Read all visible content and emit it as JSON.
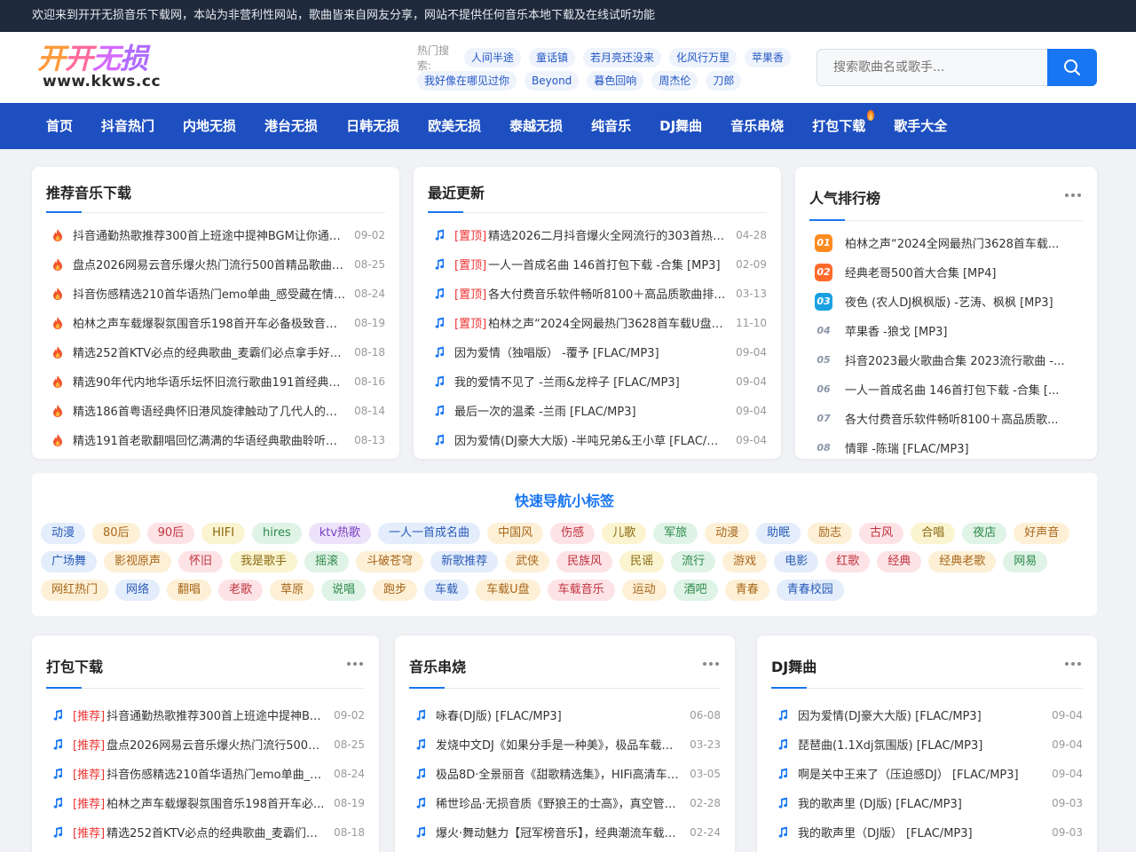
{
  "topbar": {
    "notice": "欢迎来到开开无损音乐下载网，本站为非营利性网站，歌曲皆来自网友分享，网站不提供任何音乐本地下载及在线试听功能"
  },
  "logo": {
    "chars": [
      "开",
      "开",
      "无",
      "损"
    ],
    "url": "www.kkws.cc"
  },
  "hot_search": {
    "label": "热门搜索:",
    "row1": [
      "人间半途",
      "童话镇",
      "若月亮还没来",
      "化风行万里",
      "苹果香"
    ],
    "row2": [
      "我好像在哪见过你",
      "Beyond",
      "暮色回响",
      "周杰伦",
      "刀郎"
    ]
  },
  "search": {
    "placeholder": "搜索歌曲名或歌手...",
    "icon": "search-icon"
  },
  "nav": [
    "首页",
    "抖音热门",
    "内地无损",
    "港台无损",
    "日韩无损",
    "欧美无损",
    "泰越无损",
    "纯音乐",
    "DJ舞曲",
    "音乐串烧",
    "打包下载",
    "歌手大全"
  ],
  "recommend": {
    "title": "推荐音乐下载",
    "icon": "fire-icon",
    "items": [
      {
        "text": "抖音通勤热歌推荐300首上班途中提神BGM让你通勤...",
        "date": "09-02"
      },
      {
        "text": "盘点2026网易云音乐爆火热门流行500首精品歌曲大...",
        "date": "08-25"
      },
      {
        "text": "抖音伤感精选210首华语热门emo单曲_感受藏在情歌...",
        "date": "08-24"
      },
      {
        "text": "柏林之声车载爆裂氛围音乐198首开车必备极致音效...",
        "date": "08-19"
      },
      {
        "text": "精选252首KTV必点的经典歌曲_麦霸们必点拿手好歌...",
        "date": "08-18"
      },
      {
        "text": "精选90年代内地华语乐坛怀旧流行歌曲191首经典回...",
        "date": "08-16"
      },
      {
        "text": "精选186首粤语经典怀旧港风旋律触动了几代人的青...",
        "date": "08-14"
      },
      {
        "text": "精选191首老歌翻唱回忆满满的华语经典歌曲聆听经...",
        "date": "08-13"
      }
    ]
  },
  "recent": {
    "title": "最近更新",
    "icon": "music-note-icon",
    "items": [
      {
        "tag": "[置顶]",
        "text": "精选2026二月抖音爆火全网流行的303首热门...",
        "date": "04-28"
      },
      {
        "tag": "[置顶]",
        "text": "一人一首成名曲 146首打包下载 -合集 [MP3]",
        "date": "02-09"
      },
      {
        "tag": "[置顶]",
        "text": "各大付费音乐软件畅听8100＋高品质歌曲排行...",
        "date": "03-13"
      },
      {
        "tag": "[置顶]",
        "text": "柏林之声“2024全网最热门3628首车载U盘高音...",
        "date": "11-10"
      },
      {
        "tag": "",
        "text": "因为爱情（独唱版） -覆予 [FLAC/MP3]",
        "date": "09-04"
      },
      {
        "tag": "",
        "text": "我的爱情不见了 -兰雨&龙梓子 [FLAC/MP3]",
        "date": "09-04"
      },
      {
        "tag": "",
        "text": "最后一次的温柔 -兰雨 [FLAC/MP3]",
        "date": "09-04"
      },
      {
        "tag": "",
        "text": "因为爱情(DJ豪大大版) -半吨兄弟&王小草 [FLAC/MP3]",
        "date": "09-04"
      }
    ]
  },
  "ranking": {
    "title": "人气排行榜",
    "items": [
      {
        "num": "01",
        "text": "柏林之声“2024全网最热门3628首车载..."
      },
      {
        "num": "02",
        "text": "经典老哥500首大合集 [MP4]"
      },
      {
        "num": "03",
        "text": "夜色 (农人DJ枫枫版) -艺涛、枫枫 [MP3]"
      },
      {
        "num": "04",
        "text": "苹果香 -狼戈 [MP3]"
      },
      {
        "num": "05",
        "text": "抖音2023最火歌曲合集 2023流行歌曲 -..."
      },
      {
        "num": "06",
        "text": "一人一首成名曲 146首打包下载 -合集 [..."
      },
      {
        "num": "07",
        "text": "各大付费音乐软件畅听8100＋高品质歌..."
      },
      {
        "num": "08",
        "text": "情罪 -陈瑞 [FLAC/MP3]"
      }
    ]
  },
  "quick_tags": {
    "title": "快速导航小标签",
    "items": [
      "动漫",
      "80后",
      "90后",
      "HIFI",
      "hires",
      "ktv热歌",
      "一人一首成名曲",
      "中国风",
      "伤感",
      "儿歌",
      "军旅",
      "动漫",
      "助眠",
      "励志",
      "古风",
      "合唱",
      "夜店",
      "好声音",
      "广场舞",
      "影视原声",
      "怀旧",
      "我是歌手",
      "摇滚",
      "斗破苍穹",
      "新歌推荐",
      "武侠",
      "民族风",
      "民谣",
      "流行",
      "游戏",
      "电影",
      "红歌",
      "经典",
      "经典老歌",
      "网易",
      "网红热门",
      "网络",
      "翻唱",
      "老歌",
      "草原",
      "说唱",
      "跑步",
      "车载",
      "车载U盘",
      "车载音乐",
      "运动",
      "酒吧",
      "青春",
      "青春校园"
    ],
    "palette": [
      {
        "bg": "#e3edfb",
        "fg": "#2a5bb8"
      },
      {
        "bg": "#fdf0d6",
        "fg": "#a8661a"
      },
      {
        "bg": "#fde3e6",
        "fg": "#c0333f"
      },
      {
        "bg": "#fbf4d0",
        "fg": "#8a6a10"
      },
      {
        "bg": "#dff3e6",
        "fg": "#2d8a4a"
      },
      {
        "bg": "#ece3fb",
        "fg": "#7a3ec2"
      }
    ],
    "color_index": [
      0,
      1,
      2,
      3,
      4,
      5,
      0,
      1,
      2,
      3,
      4,
      1,
      0,
      1,
      2,
      3,
      4,
      1,
      0,
      1,
      2,
      3,
      4,
      1,
      0,
      1,
      2,
      3,
      4,
      1,
      0,
      2,
      2,
      1,
      4,
      1,
      0,
      1,
      2,
      1,
      4,
      1,
      0,
      1,
      2,
      1,
      4,
      1,
      0
    ]
  },
  "pack": {
    "title": "打包下载",
    "items": [
      {
        "tag": "[推荐]",
        "text": "抖音通勤热歌推荐300首上班途中提神BG...",
        "date": "09-02"
      },
      {
        "tag": "[推荐]",
        "text": "盘点2026网易云音乐爆火热门流行500首...",
        "date": "08-25"
      },
      {
        "tag": "[推荐]",
        "text": "抖音伤感精选210首华语热门emo单曲_感...",
        "date": "08-24"
      },
      {
        "tag": "[推荐]",
        "text": "柏林之声车载爆裂氛围音乐198首开车必...",
        "date": "08-19"
      },
      {
        "tag": "[推荐]",
        "text": "精选252首KTV必点的经典歌曲_麦霸们必...",
        "date": "08-18"
      }
    ]
  },
  "medley": {
    "title": "音乐串烧",
    "items": [
      {
        "text": "咏春(DJ版) [FLAC/MP3]",
        "date": "06-08"
      },
      {
        "text": "发烧中文DJ《如果分手是一种美》，极品车载CL...",
        "date": "03-23"
      },
      {
        "text": "极品8D·全景丽音《甜歌精选集》，HIFi高清车载...",
        "date": "03-05"
      },
      {
        "text": "稀世珍品·无损音质《野狼王的士高》，真空管原...",
        "date": "02-28"
      },
      {
        "text": "爆火·舞动魅力【冠军榜音乐】，经典潮流车载音...",
        "date": "02-24"
      }
    ]
  },
  "dj": {
    "title": "DJ舞曲",
    "items": [
      {
        "text": "因为爱情(DJ豪大大版) [FLAC/MP3]",
        "date": "09-04"
      },
      {
        "text": "琵琶曲(1.1Xdj氛围版) [FLAC/MP3]",
        "date": "09-04"
      },
      {
        "text": "啊是关中王来了（压迫感DJ） [FLAC/MP3]",
        "date": "09-04"
      },
      {
        "text": "我的歌声里 (DJ版) [FLAC/MP3]",
        "date": "09-03"
      },
      {
        "text": "我的歌声里（DJ版） [FLAC/MP3]",
        "date": "09-03"
      }
    ]
  }
}
